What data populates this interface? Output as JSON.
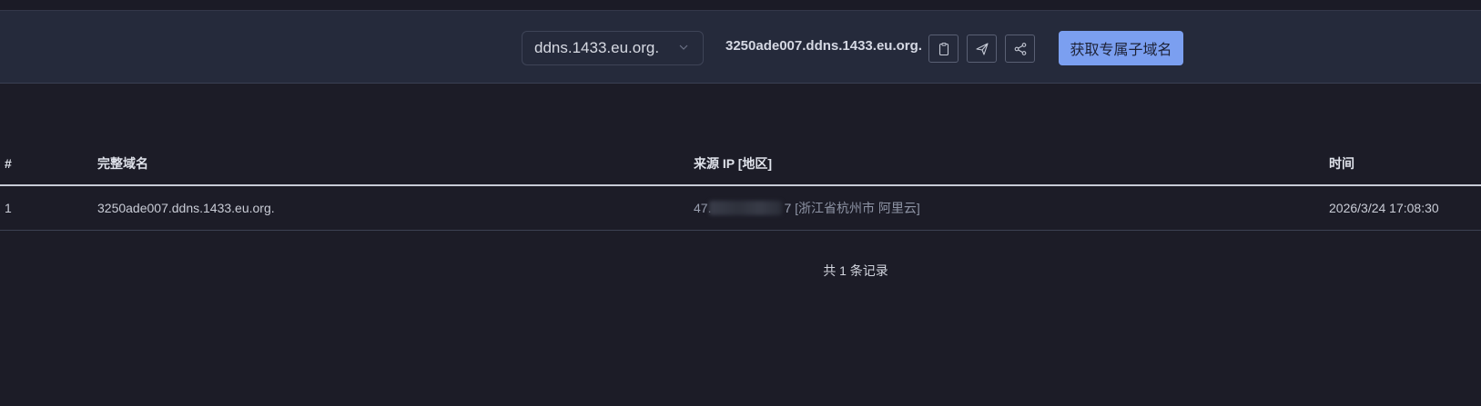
{
  "toolbar": {
    "domain_select": {
      "value": "ddns.1433.eu.org."
    },
    "current_subdomain": "3250ade007.ddns.1433.eu.org.",
    "icons": [
      "clipboard-icon",
      "send-icon",
      "share-icon"
    ],
    "primary_button": "获取专属子域名"
  },
  "table": {
    "headers": [
      "#",
      "完整域名",
      "来源 IP [地区]",
      "时间"
    ],
    "rows": [
      {
        "index": "1",
        "domain": "3250ade007.ddns.1433.eu.org.",
        "ip_prefix": "47.",
        "ip_suffix": "7",
        "region": "[浙江省杭州市 阿里云]",
        "time": "2026/3/24 17:08:30"
      }
    ]
  },
  "footer": {
    "count_text": "共 1 条记录"
  },
  "colors": {
    "background": "#1c1c27",
    "toolbar": "#252a3b",
    "accent": "#7b9ff0"
  }
}
